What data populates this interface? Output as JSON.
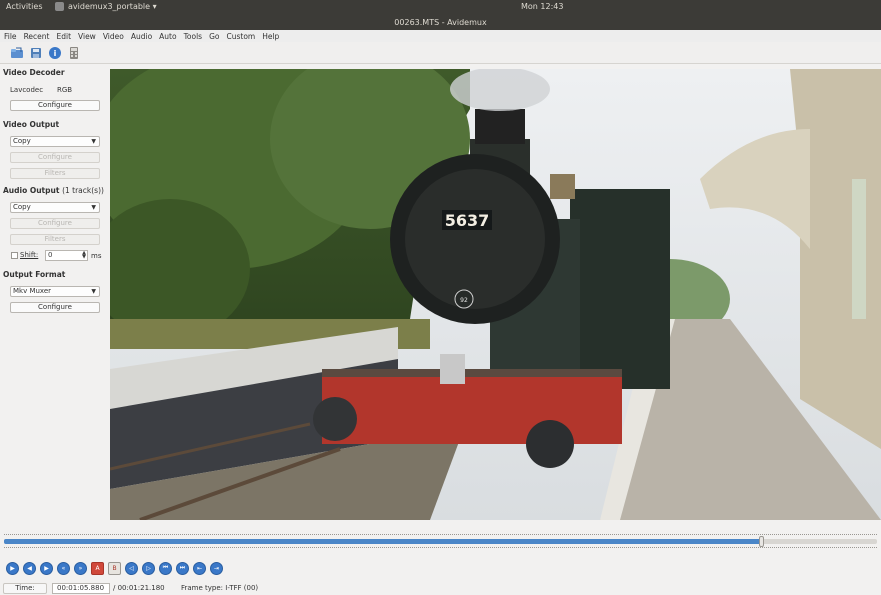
{
  "topbar": {
    "activities": "Activities",
    "app_name": "avidemux3_portable ▾",
    "clock": "Mon 12:43"
  },
  "window": {
    "title": "00263.MTS - Avidemux"
  },
  "menu": [
    "File",
    "Recent",
    "Edit",
    "View",
    "Video",
    "Audio",
    "Auto",
    "Tools",
    "Go",
    "Custom",
    "Help"
  ],
  "toolbar": {
    "icons": [
      "open-file-icon",
      "save-file-icon",
      "info-icon",
      "calculator-icon"
    ]
  },
  "sidebar": {
    "video_decoder": {
      "title": "Video Decoder",
      "codec_label": "Lavcodec",
      "codec_value": "RGB",
      "configure": "Configure"
    },
    "video_output": {
      "title": "Video Output",
      "selected": "Copy",
      "configure": "Configure",
      "filters": "Filters"
    },
    "audio_output": {
      "title": "Audio Output",
      "tracks": "(1 track(s))",
      "selected": "Copy",
      "configure": "Configure",
      "filters": "Filters",
      "shift_label": "Shift:",
      "shift_value": "0",
      "shift_unit": "ms"
    },
    "output_format": {
      "title": "Output Format",
      "selected": "Mkv Muxer",
      "configure": "Configure"
    }
  },
  "video": {
    "locomotive_number": "5637",
    "smokebox_plate": "92"
  },
  "scrubber": {
    "position_fraction": 0.867
  },
  "navigation": {
    "buttons": [
      "play-icon",
      "previous-frame-icon",
      "next-frame-icon",
      "rewind-icon",
      "fast-forward-icon",
      "set-marker-a-icon",
      "set-marker-b-icon",
      "previous-black-frame-icon",
      "next-black-frame-icon",
      "first-frame-icon",
      "last-frame-icon",
      "go-to-marker-a-icon",
      "go-to-marker-b-icon"
    ]
  },
  "status": {
    "time_label": "Time:",
    "current_time": "00:01:05.880",
    "total_time": "/ 00:01:21.180",
    "frame_type": "Frame type:  I-TFF (00)"
  },
  "colors": {
    "accent": "#3a78c8",
    "title_bg": "#3c3b37",
    "marker": "#d0483a"
  }
}
